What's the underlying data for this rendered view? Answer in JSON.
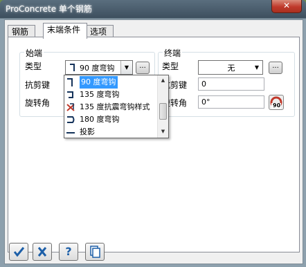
{
  "window": {
    "title": "ProConcrete 单个钢筋",
    "close_label": "✕"
  },
  "tabs": [
    {
      "label": "钢筋",
      "active": false
    },
    {
      "label": "末端条件",
      "active": true
    },
    {
      "label": "选项",
      "active": false
    }
  ],
  "start_group": {
    "label": "始端",
    "type_label": "类型",
    "type_value": "90  度弯钩",
    "shear_label": "抗剪键",
    "rotation_label": "旋转角",
    "browse_label": "..."
  },
  "end_group": {
    "label": "终端",
    "type_label": "类型",
    "type_value": "无",
    "shear_label": "抗剪键",
    "shear_value": "0",
    "rotation_label": "旋转角",
    "rotation_value": "0°",
    "browse_label": "...",
    "rotate_button_label": "90"
  },
  "dropdown": {
    "options": [
      {
        "label": "90  度弯钩",
        "icon": "hook-90-icon",
        "selected": true
      },
      {
        "label": "135  度弯钩",
        "icon": "hook-135-icon",
        "selected": false
      },
      {
        "label": "135  度抗震弯钩样式",
        "icon": "seismic-hook-icon",
        "selected": false
      },
      {
        "label": "180  度弯钩",
        "icon": "hook-180-icon",
        "selected": false
      },
      {
        "label": "投影",
        "icon": "projection-icon",
        "selected": false
      }
    ]
  },
  "toolbar": {
    "ok_icon": "checkmark-icon",
    "cancel_icon": "cancel-icon",
    "help_label": "?",
    "copy_icon": "copy-icon"
  }
}
